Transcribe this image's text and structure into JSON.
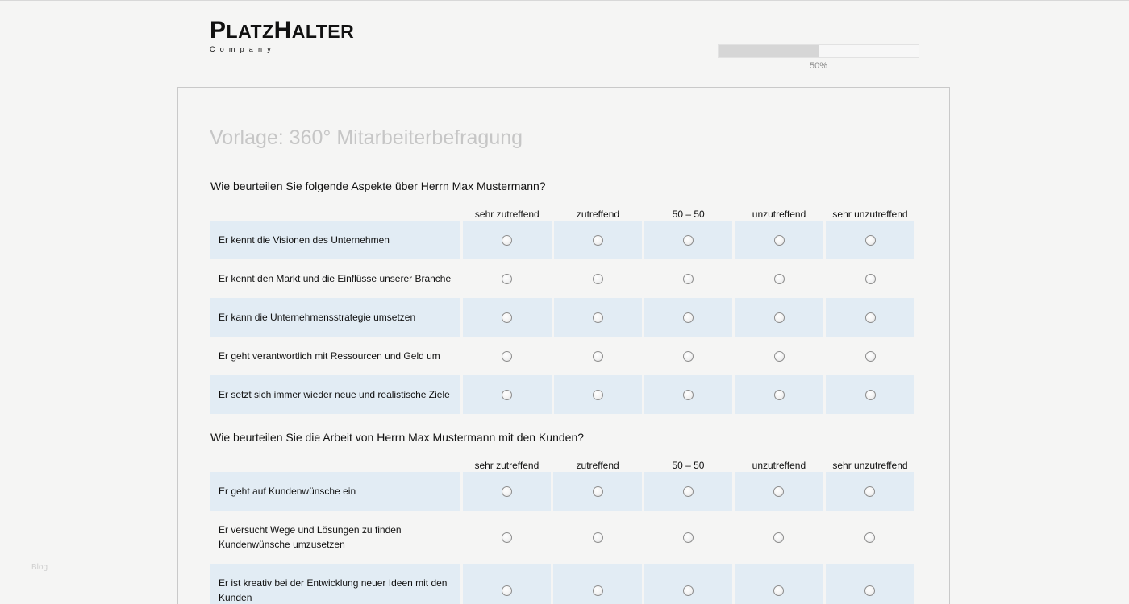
{
  "logo": {
    "main_cap1": "P",
    "main_rest1": "LATZ",
    "main_cap2": "H",
    "main_rest2": "ALTER",
    "sub": "Company"
  },
  "progress": {
    "value": 0.5,
    "label": "50%"
  },
  "survey": {
    "title": "Vorlage: 360° Mitarbeiterbefragung"
  },
  "scale": [
    "sehr zutreffend",
    "zutreffend",
    "50 – 50",
    "unzutreffend",
    "sehr unzutreffend"
  ],
  "questions": [
    {
      "title": "Wie beurteilen Sie folgende Aspekte über Herrn Max Mustermann?",
      "scale": [
        "sehr zutreffend",
        "zutreffend",
        "50 – 50",
        "unzutreffend",
        "sehr unzutreffend"
      ],
      "rows": [
        "Er kennt die Visionen des Unternehmen",
        "Er kennt den Markt und die Einflüsse unserer Branche",
        "Er kann die Unternehmensstrategie umsetzen",
        "Er geht verantwortlich mit Ressourcen und Geld um",
        "Er setzt sich immer wieder neue und realistische Ziele"
      ]
    },
    {
      "title": "Wie beurteilen Sie die Arbeit von Herrn Max Mustermann mit den Kunden?",
      "scale": [
        "sehr zutreffend",
        "zutreffend",
        "50 – 50",
        "unzutreffend",
        "sehr unzutreffend"
      ],
      "rows": [
        "Er geht auf Kundenwünsche ein",
        "Er versucht Wege und Lösungen zu finden Kundenwünsche umzusetzen",
        "Er ist kreativ bei der Entwicklung neuer Ideen mit den Kunden"
      ]
    }
  ],
  "watermark": "Blog",
  "colors": {
    "row_shade": "#e2ecf4",
    "progress_fill": "#d6d6d6",
    "title_gray": "#c6c6c6"
  }
}
